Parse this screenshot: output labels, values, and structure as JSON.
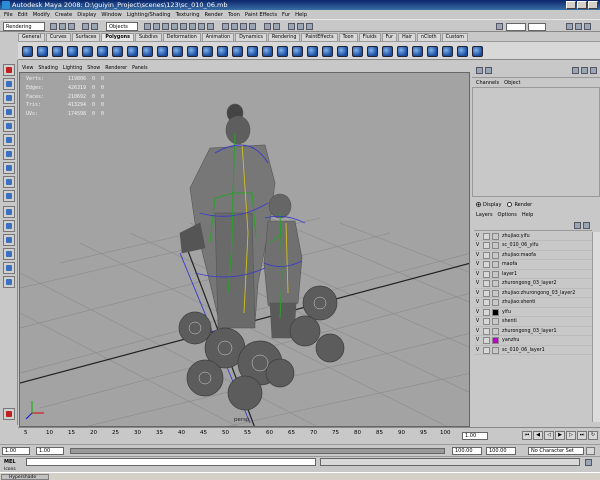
{
  "window": {
    "title": "Autodesk Maya 2008: D:\\guiyin_Project\\scenes\\123\\sc_010_06.mb"
  },
  "menubar": [
    "File",
    "Edit",
    "Modify",
    "Create",
    "Display",
    "Window",
    "Lighting/Shading",
    "Texturing",
    "Render",
    "Toon",
    "Paint Effects",
    "Fur",
    "Help"
  ],
  "statusline": {
    "menu_set": "Rendering",
    "selection_mode": "Objects"
  },
  "shelf": {
    "tabs": [
      "General",
      "Curves",
      "Surfaces",
      "Polygons",
      "Subdivs",
      "Deformation",
      "Animation",
      "Dynamics",
      "Rendering",
      "PaintEffects",
      "Toon",
      "Fluids",
      "Fur",
      "Hair",
      "nCloth",
      "Custom"
    ],
    "active_tab": "Polygons"
  },
  "viewport": {
    "menu": [
      "View",
      "Shading",
      "Lighting",
      "Show",
      "Renderer",
      "Panels"
    ],
    "hud": [
      {
        "label": "Verts:",
        "value": "119806",
        "a": "0",
        "b": "0"
      },
      {
        "label": "Edges:",
        "value": "426319",
        "a": "0",
        "b": "0"
      },
      {
        "label": "Faces:",
        "value": "210692",
        "a": "0",
        "b": "0"
      },
      {
        "label": "Tris:",
        "value": "413294",
        "a": "0",
        "b": "0"
      },
      {
        "label": "UVs:",
        "value": "174598",
        "a": "0",
        "b": "0"
      }
    ],
    "camera": "persp"
  },
  "channel_box": {
    "menu": [
      "Channels",
      "Object"
    ]
  },
  "layer_editor": {
    "modes": [
      "Display",
      "Render"
    ],
    "active_mode": "Display",
    "menu": [
      "Layers",
      "Options",
      "Help"
    ],
    "layers": [
      {
        "v": "V",
        "name": "zhujiao:yifu",
        "color": ""
      },
      {
        "v": "V",
        "name": "sc_010_06_yifu",
        "color": ""
      },
      {
        "v": "V",
        "name": "zhujiao:maofa",
        "color": ""
      },
      {
        "v": "V",
        "name": "maofa",
        "color": ""
      },
      {
        "v": "V",
        "name": "layer1",
        "color": ""
      },
      {
        "v": "V",
        "name": "zhurongong_03_layer2",
        "color": ""
      },
      {
        "v": "V",
        "name": "zhujiao:zhurongong_03_layer2",
        "color": ""
      },
      {
        "v": "V",
        "name": "zhujiao:shenti",
        "color": ""
      },
      {
        "v": "V",
        "name": "yifu",
        "color": "#000000"
      },
      {
        "v": "V",
        "name": "shenti",
        "color": ""
      },
      {
        "v": "V",
        "name": "zhurongong_03_layer1",
        "color": ""
      },
      {
        "v": "V",
        "name": "yanzhu",
        "color": "#c000c0"
      },
      {
        "v": "V",
        "name": "sc_010_06_layer1",
        "color": ""
      }
    ]
  },
  "timeline": {
    "ticks": [
      "5",
      "10",
      "15",
      "20",
      "25",
      "30",
      "35",
      "40",
      "45",
      "50",
      "55",
      "60",
      "65",
      "70",
      "75",
      "80",
      "85",
      "90",
      "95",
      "100"
    ],
    "current_frame": "1.00"
  },
  "range": {
    "start": "1.00",
    "inner_start": "1.00",
    "inner_end": "100.00",
    "end": "100.00",
    "character": "No Character Set"
  },
  "cmdline": {
    "label": "MEL"
  },
  "helpline": "Icons",
  "taskbar": {
    "app": "Hypershade"
  }
}
